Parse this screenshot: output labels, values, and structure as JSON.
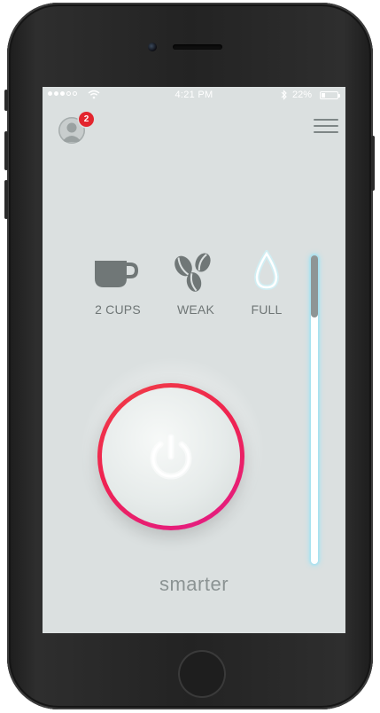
{
  "status_bar": {
    "time": "4:21 PM",
    "battery_percent": "22%",
    "battery_level": 0.22
  },
  "header": {
    "notification_count": "2",
    "avatar_icon": "user-avatar-icon",
    "menu_icon": "hamburger-menu-icon"
  },
  "settings": [
    {
      "icon": "coffee-cup-icon",
      "label": "2 CUPS"
    },
    {
      "icon": "coffee-beans-icon",
      "label": "WEAK"
    },
    {
      "icon": "water-drop-icon",
      "label": "FULL"
    }
  ],
  "power": {
    "icon": "power-icon"
  },
  "water_level": {
    "fraction": 0.8
  },
  "brand": "smarter",
  "colors": {
    "screen_bg": "#dbe0e0",
    "badge": "#e3252e",
    "ring_start": "#f03e46",
    "ring_end": "#e21b8a",
    "water_glow": "#aae6f5",
    "icon_gray": "#6f7676"
  }
}
